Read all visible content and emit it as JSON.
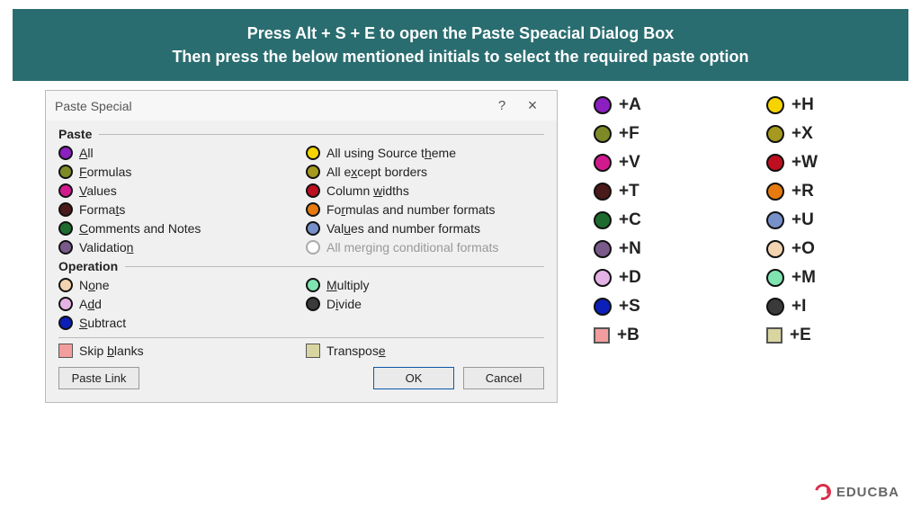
{
  "banner": {
    "line1": "Press Alt + S + E to open the Paste Speacial Dialog Box",
    "line2": "Then press the below mentioned initials to select the required paste option"
  },
  "dialog": {
    "title": "Paste Special",
    "help": "?",
    "close": "×",
    "paste_group_label": "Paste",
    "operation_group_label": "Operation",
    "paste_options_left": [
      {
        "pre": "",
        "u": "A",
        "post": "ll",
        "color": "#8c1fbf"
      },
      {
        "pre": "",
        "u": "F",
        "post": "ormulas",
        "color": "#7e8a28"
      },
      {
        "pre": "",
        "u": "V",
        "post": "alues",
        "color": "#d21a8f"
      },
      {
        "pre": "Forma",
        "u": "t",
        "post": "s",
        "color": "#4b1a1a"
      },
      {
        "pre": "",
        "u": "C",
        "post": "omments and Notes",
        "color": "#1f6b2f"
      },
      {
        "pre": "Validatio",
        "u": "n",
        "post": "",
        "color": "#7a5a8a"
      }
    ],
    "paste_options_right": [
      {
        "pre": "All using Source t",
        "u": "h",
        "post": "eme",
        "color": "#f5d400"
      },
      {
        "pre": "All e",
        "u": "x",
        "post": "cept borders",
        "color": "#a5991f"
      },
      {
        "pre": "Column ",
        "u": "w",
        "post": "idths",
        "color": "#bd0f1f"
      },
      {
        "pre": "Fo",
        "u": "r",
        "post": "mulas and number formats",
        "color": "#e67a0f"
      },
      {
        "pre": "Val",
        "u": "u",
        "post": "es and number formats",
        "color": "#7690c9"
      },
      {
        "pre": "All merging conditional formats",
        "u": "",
        "post": "",
        "disabled": true
      }
    ],
    "operation_options_left": [
      {
        "pre": "N",
        "u": "o",
        "post": "ne",
        "color": "#f3d4b0"
      },
      {
        "pre": "A",
        "u": "d",
        "post": "d",
        "color": "#e4b2e4"
      },
      {
        "pre": "",
        "u": "S",
        "post": "ubtract",
        "color": "#0c1fb8"
      }
    ],
    "operation_options_right": [
      {
        "pre": "",
        "u": "M",
        "post": "ultiply",
        "color": "#7fe4b0"
      },
      {
        "pre": "D",
        "u": "i",
        "post": "vide",
        "color": "#3a3a3a"
      }
    ],
    "skip_blanks": {
      "pre": "Skip ",
      "u": "b",
      "post": "lanks",
      "color": "#f29e9e"
    },
    "transpose": {
      "pre": "Transpos",
      "u": "e",
      "post": "",
      "color": "#d8d5a0"
    },
    "paste_link_label": "Paste Link",
    "ok_label": "OK",
    "cancel_label": "Cancel"
  },
  "legend_left": [
    {
      "key": "+A",
      "color": "#8c1fbf",
      "shape": "dot"
    },
    {
      "key": "+F",
      "color": "#7e8a28",
      "shape": "dot"
    },
    {
      "key": "+V",
      "color": "#d21a8f",
      "shape": "dot"
    },
    {
      "key": "+T",
      "color": "#4b1a1a",
      "shape": "dot"
    },
    {
      "key": "+C",
      "color": "#1f6b2f",
      "shape": "dot"
    },
    {
      "key": "+N",
      "color": "#7a5a8a",
      "shape": "dot"
    },
    {
      "key": "+D",
      "color": "#e4b2e4",
      "shape": "dot"
    },
    {
      "key": "+S",
      "color": "#0c1fb8",
      "shape": "dot"
    },
    {
      "key": "+B",
      "color": "#f29e9e",
      "shape": "square"
    }
  ],
  "legend_right": [
    {
      "key": "+H",
      "color": "#f5d400",
      "shape": "dot"
    },
    {
      "key": "+X",
      "color": "#a5991f",
      "shape": "dot"
    },
    {
      "key": "+W",
      "color": "#bd0f1f",
      "shape": "dot"
    },
    {
      "key": "+R",
      "color": "#e67a0f",
      "shape": "dot"
    },
    {
      "key": "+U",
      "color": "#7690c9",
      "shape": "dot"
    },
    {
      "key": "+O",
      "color": "#f3d4b0",
      "shape": "dot"
    },
    {
      "key": "+M",
      "color": "#7fe4b0",
      "shape": "dot"
    },
    {
      "key": "+I",
      "color": "#3a3a3a",
      "shape": "dot"
    },
    {
      "key": "+E",
      "color": "#d8d5a0",
      "shape": "square"
    }
  ],
  "logo_text": "EDUCBA"
}
